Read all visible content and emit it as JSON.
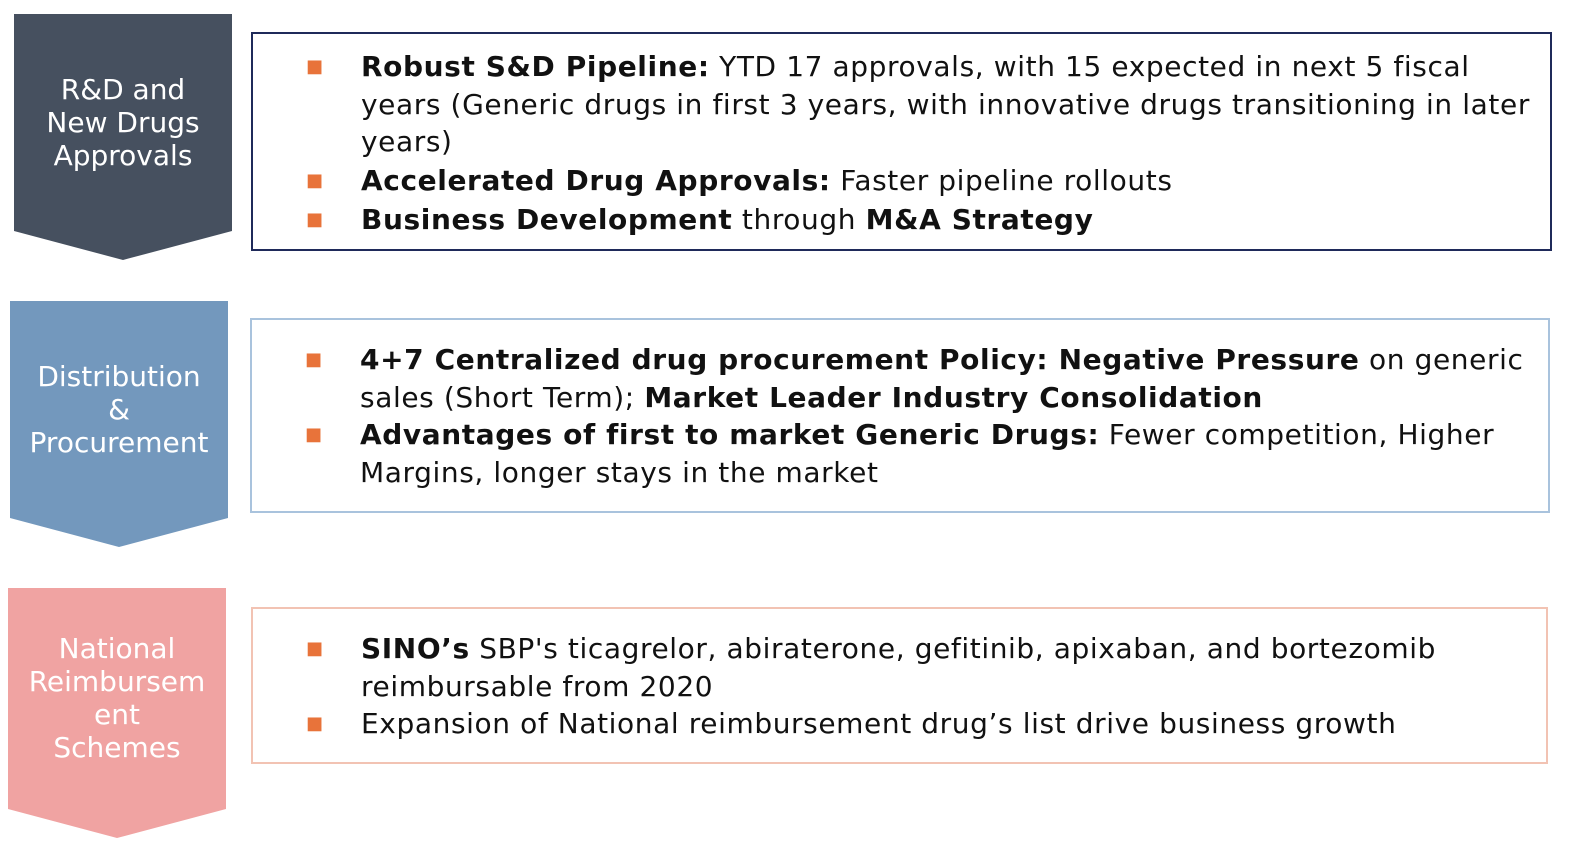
{
  "colors": {
    "chevron_1": "#46505f",
    "chevron_2": "#7398bd",
    "chevron_3": "#f0a3a2",
    "bullet_marker": "#e8733a"
  },
  "sections": [
    {
      "label": "R&D and\nNew Drugs\nApprovals",
      "bullets": [
        {
          "parts": [
            {
              "t": "Robust S&D Pipeline:",
              "b": true
            },
            {
              "t": " YTD 17 approvals, with 15 expected in next 5 fiscal years (Generic drugs in first 3 years, with innovative drugs transitioning in later years)",
              "b": false
            }
          ]
        },
        {
          "parts": [
            {
              "t": "Accelerated Drug Approvals:",
              "b": true
            },
            {
              "t": " Faster pipeline rollouts",
              "b": false
            }
          ]
        },
        {
          "parts": [
            {
              "t": "Business Development",
              "b": true
            },
            {
              "t": " through ",
              "b": false
            },
            {
              "t": "M&A Strategy",
              "b": true
            }
          ]
        }
      ]
    },
    {
      "label": "Distribution\n&\nProcurement",
      "bullets": [
        {
          "parts": [
            {
              "t": "4+7 Centralized drug procurement Policy: Negative Pressure",
              "b": true
            },
            {
              "t": " on generic sales (Short Term); ",
              "b": false
            },
            {
              "t": "Market Leader Industry Consolidation",
              "b": true
            }
          ]
        },
        {
          "parts": [
            {
              "t": "Advantages of first to market Generic Drugs:",
              "b": true
            },
            {
              "t": " Fewer competition, Higher Margins, longer stays in the market",
              "b": false
            }
          ]
        }
      ]
    },
    {
      "label": "National\nReimbursem\nent\nSchemes",
      "bullets": [
        {
          "parts": [
            {
              "t": "SINO’s",
              "b": true
            },
            {
              "t": " SBP's ticagrelor, abiraterone, gefitinib, apixaban, and bortezomib reimbursable from 2020",
              "b": false
            }
          ]
        },
        {
          "parts": [
            {
              "t": "Expansion of National reimbursement drug’s list drive business growth",
              "b": false
            }
          ]
        }
      ]
    }
  ]
}
